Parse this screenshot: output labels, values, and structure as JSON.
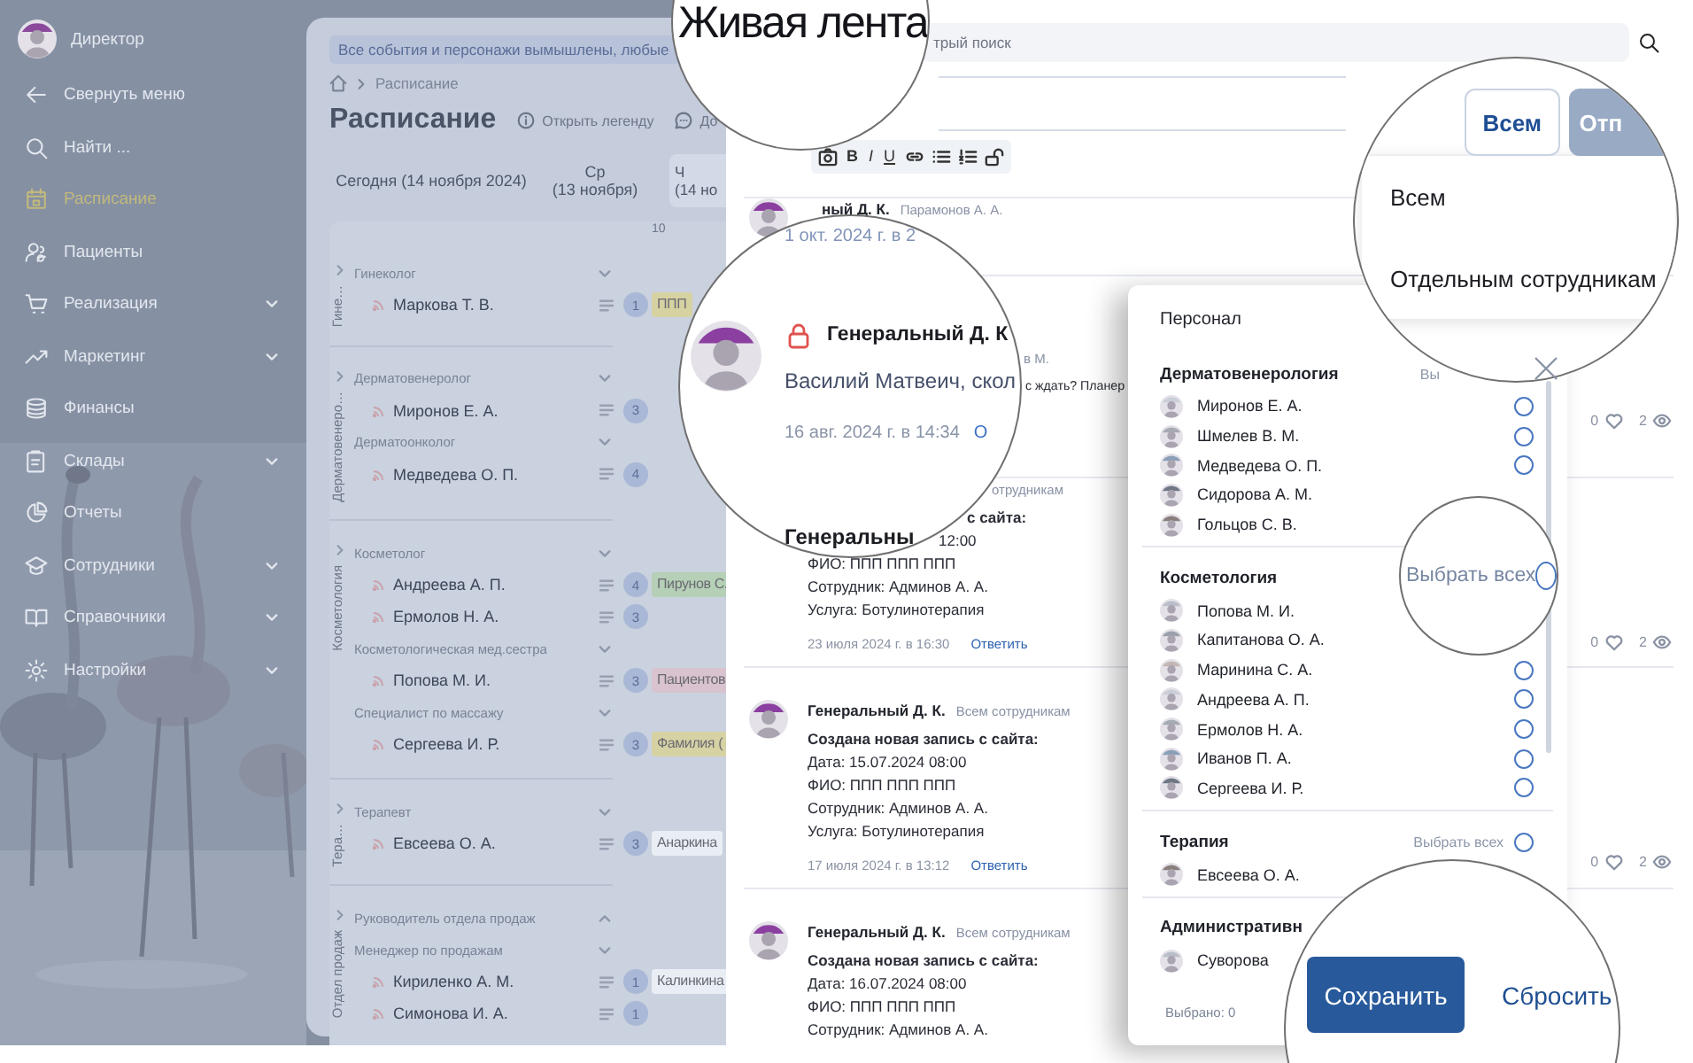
{
  "sidebar": {
    "user": {
      "name": "Директор"
    },
    "items": [
      {
        "label": "Свернуть меню",
        "selected": false,
        "expandable": false
      },
      {
        "label": "Найти ...",
        "selected": false,
        "expandable": false
      },
      {
        "label": "Расписание",
        "selected": true,
        "expandable": false
      },
      {
        "label": "Пациенты",
        "selected": false,
        "expandable": false
      },
      {
        "label": "Реализация",
        "selected": false,
        "expandable": true
      },
      {
        "label": "Маркетинг",
        "selected": false,
        "expandable": true
      },
      {
        "label": "Финансы",
        "selected": false,
        "expandable": false
      },
      {
        "label": "Склады",
        "selected": false,
        "expandable": true
      },
      {
        "label": "Отчеты",
        "selected": false,
        "expandable": false
      },
      {
        "label": "Сотрудники",
        "selected": false,
        "expandable": true
      },
      {
        "label": "Справочники",
        "selected": false,
        "expandable": true
      },
      {
        "label": "Настройки",
        "selected": false,
        "expandable": true
      }
    ]
  },
  "schedule": {
    "notice": "Все события и персонажи вымышлены, любые",
    "breadcrumb": [
      "Расписание"
    ],
    "title": "Расписание",
    "actions": [
      "Открыть легенду",
      "До"
    ],
    "day_tabs": [
      {
        "lines": [
          "Сегодня (14 ноября 2024)"
        ],
        "selected": false
      },
      {
        "lines": [
          "Ср",
          "(13 ноября)"
        ],
        "selected": false
      },
      {
        "lines": [
          "Ч",
          "(14 но"
        ],
        "selected": true
      }
    ],
    "hour": "10",
    "groups": [
      {
        "label": "Гине…",
        "rows": [
          {
            "kind": "role",
            "text": "Гинеколог",
            "expanded": true
          },
          {
            "kind": "person",
            "text": "Маркова Т. В.",
            "count": "1",
            "chips": [
              {
                "text": "ППП",
                "color": "#d6d2a2"
              }
            ]
          }
        ]
      },
      {
        "label": "Дерматовенеро…",
        "rows": [
          {
            "kind": "role",
            "text": "Дерматовенеролог",
            "expanded": true
          },
          {
            "kind": "person",
            "text": "Миронов Е. А.",
            "count": "3"
          },
          {
            "kind": "role",
            "text": "Дерматоонколог",
            "expanded": true
          },
          {
            "kind": "person",
            "text": "Медведева О. П.",
            "count": "4"
          }
        ]
      },
      {
        "label": "Косметология",
        "rows": [
          {
            "kind": "role",
            "text": "Косметолог",
            "expanded": true
          },
          {
            "kind": "person",
            "text": "Андреева А. П.",
            "count": "4",
            "chips": [
              {
                "text": "Пирунов С.",
                "color": "#b5d0b6"
              }
            ]
          },
          {
            "kind": "person",
            "text": "Ермолов Н. А.",
            "count": "3"
          },
          {
            "kind": "role",
            "text": "Косметологическая мед.сестра",
            "expanded": true
          },
          {
            "kind": "person",
            "text": "Попова М. И.",
            "count": "3",
            "chips": [
              {
                "text": "Пациентов",
                "color": "#d9c3ce"
              }
            ]
          },
          {
            "kind": "role",
            "text": "Специалист по массажу",
            "expanded": true
          },
          {
            "kind": "person",
            "text": "Сергеева И. Р.",
            "count": "3",
            "chips": [
              {
                "text": "Фамилия (",
                "color": "#d7d2a4"
              }
            ]
          }
        ]
      },
      {
        "label": "Тера…",
        "rows": [
          {
            "kind": "role",
            "text": "Терапевт",
            "expanded": true
          },
          {
            "kind": "person",
            "text": "Евсеева О. А.",
            "count": "3",
            "chips": [
              {
                "text": "Анаркина",
                "color": "#e9edf4"
              }
            ]
          }
        ]
      },
      {
        "label": "Отдел продаж",
        "rows": [
          {
            "kind": "role",
            "text": "Руководитель отдела продаж",
            "expanded": false
          },
          {
            "kind": "role",
            "text": "Менеджер по продажам",
            "expanded": true
          },
          {
            "kind": "person",
            "text": "Кириленко А. М.",
            "count": "1",
            "chips": [
              {
                "text": "Калинкина",
                "color": "#e9edf4"
              }
            ]
          },
          {
            "kind": "person",
            "text": "Симонова И. А.",
            "count": "1"
          }
        ]
      }
    ]
  },
  "feed": {
    "search": {
      "placeholder": "трый поиск"
    },
    "format_buttons": [
      "B",
      "I",
      "U"
    ],
    "posts": [
      {
        "kind": "full",
        "author": "ный Д. К.",
        "recipient": "Парамонов А. А."
      },
      {
        "kind": "partial",
        "recipient": "в М.",
        "lines": [
          {
            "text": "с ждать? Планер",
            "bold": false
          }
        ],
        "likes": "0",
        "views": "2"
      },
      {
        "kind": "partial",
        "recipient": "отрудникам",
        "lines": [
          {
            "text": "с сайта:",
            "bold": true
          },
          {
            "text": "12:00",
            "bold": false
          },
          {
            "text": "ФИО: ППП ППП ППП",
            "bold": false
          },
          {
            "text": "Сотрудник: Админов А. А.",
            "bold": false
          },
          {
            "text": "Услуга: Ботулинотерапия",
            "bold": false
          }
        ],
        "date": "23 июля 2024 г. в 16:30",
        "reply": "Ответить",
        "likes": "0",
        "views": "2"
      },
      {
        "kind": "full",
        "author": "Генеральный Д. К.",
        "recipient": "Всем сотрудникам",
        "lines": [
          {
            "text": "Создана новая запись с сайта:",
            "bold": true
          },
          {
            "text": "Дата: 15.07.2024 08:00",
            "bold": false
          },
          {
            "text": "ФИО: ППП ППП ППП",
            "bold": false
          },
          {
            "text": "Сотрудник: Админов А. А.",
            "bold": false
          },
          {
            "text": "Услуга: Ботулинотерапия",
            "bold": false
          }
        ],
        "date": "17 июля 2024 г. в 13:12",
        "reply": "Ответить",
        "likes": "0",
        "views": "2"
      },
      {
        "kind": "full",
        "author": "Генеральный Д. К.",
        "recipient": "Всем сотрудникам",
        "lines": [
          {
            "text": "Создана новая запись с сайта:",
            "bold": true
          },
          {
            "text": "Дата: 16.07.2024 08:00",
            "bold": false
          },
          {
            "text": "ФИО: ППП ППП ППП",
            "bold": false
          },
          {
            "text": "Сотрудник: Админов А. А.",
            "bold": false
          }
        ]
      }
    ]
  },
  "staff_popup": {
    "title": "Персонал",
    "sections": [
      {
        "title": "Дерматовенерология",
        "select_all": {
          "label": "Вы"
        },
        "people": [
          {
            "name": "Миронов Е. А.",
            "checked": false
          },
          {
            "name": "Шмелев В. М.",
            "checked": false
          },
          {
            "name": "Медведева О. П.",
            "checked": false
          },
          {
            "name": "Сидорова А. М."
          },
          {
            "name": "Гольцов С. В."
          }
        ]
      },
      {
        "title": "Косметология",
        "people": [
          {
            "name": "Попова М. И."
          },
          {
            "name": "Капитанова О. А."
          },
          {
            "name": "Маринина С. А.",
            "checked": false
          },
          {
            "name": "Андреева А. П.",
            "checked": false
          },
          {
            "name": "Ермолов Н. А.",
            "checked": false
          },
          {
            "name": "Иванов П. А.",
            "checked": false
          },
          {
            "name": "Сергеева И. Р.",
            "checked": false
          }
        ]
      },
      {
        "title": "Терапия",
        "select_all": {
          "label": "Выбрать всех",
          "checked": false
        },
        "people": [
          {
            "name": "Евсеева О. А."
          }
        ]
      },
      {
        "title": "Административн",
        "people": [
          {
            "name": "Суворова"
          }
        ]
      }
    ],
    "selected_count": "Выбрано: 0"
  },
  "lenses": [
    {
      "kind": "title",
      "text": "Живая лента"
    },
    {
      "kind": "post",
      "date_above": "1 окт. 2024 г. в 2",
      "locked": true,
      "author": "Генеральный Д. К",
      "text": "Василий Матвеич, скол",
      "date": "16 авг. 2024 г. в 14:34",
      "reply": "О",
      "next_author": "Генеральны"
    },
    {
      "kind": "audience",
      "buttons": [
        {
          "label": "Всем",
          "disabled": false
        },
        {
          "label": "Отп",
          "disabled": true
        }
      ],
      "menu": [
        "Всем",
        "Отдельным сотрудникам"
      ]
    },
    {
      "kind": "select_all",
      "label": "Выбрать всех",
      "checked": false
    },
    {
      "kind": "actions",
      "primary": "Сохранить",
      "secondary": "Сбросить"
    }
  ]
}
